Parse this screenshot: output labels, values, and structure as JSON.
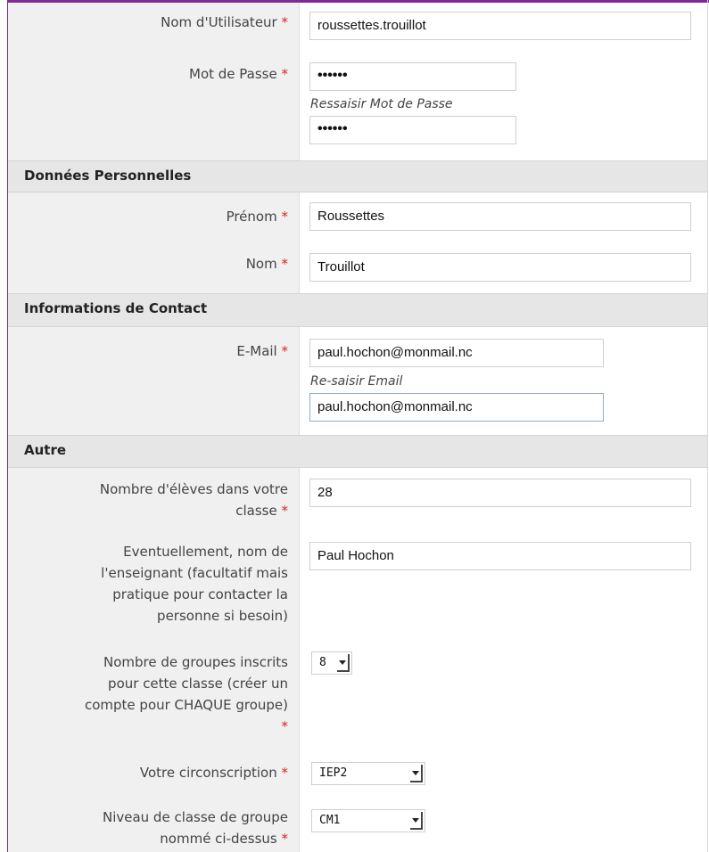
{
  "account": {
    "username_label": "Nom d'Utilisateur",
    "username_value": "roussettes.trouillot",
    "password_label": "Mot de Passe",
    "password_value": "••••••",
    "password_confirm_label": "Ressaisir Mot de Passe",
    "password_confirm_value": "••••••"
  },
  "personal": {
    "section_title": "Données Personnelles",
    "firstname_label": "Prénom",
    "firstname_value": "Roussettes",
    "lastname_label": "Nom",
    "lastname_value": "Trouillot"
  },
  "contact": {
    "section_title": "Informations de Contact",
    "email_label": "E-Mail",
    "email_value": "paul.hochon@monmail.nc",
    "email_confirm_label": "Re-saisir Email",
    "email_confirm_value": "paul.hochon@monmail.nc"
  },
  "other": {
    "section_title": "Autre",
    "students_label_1": "Nombre d'élèves dans votre",
    "students_label_2": "classe",
    "students_value": "28",
    "teacher_label_1": "Eventuellement, nom de",
    "teacher_label_2": "l'enseignant (facultatif mais",
    "teacher_label_3": "pratique pour contacter la",
    "teacher_label_4": "personne si besoin)",
    "teacher_value": "Paul Hochon",
    "groups_label_1": "Nombre de groupes inscrits",
    "groups_label_2": "pour cette classe (créer un",
    "groups_label_3": "compte pour CHAQUE groupe)",
    "groups_value": "8",
    "district_label": "Votre circonscription",
    "district_value": "IEP2",
    "level_label_1": "Niveau de classe de groupe",
    "level_label_2": "nommé ci-dessus",
    "level_value": "CM1"
  },
  "required_mark": "*"
}
